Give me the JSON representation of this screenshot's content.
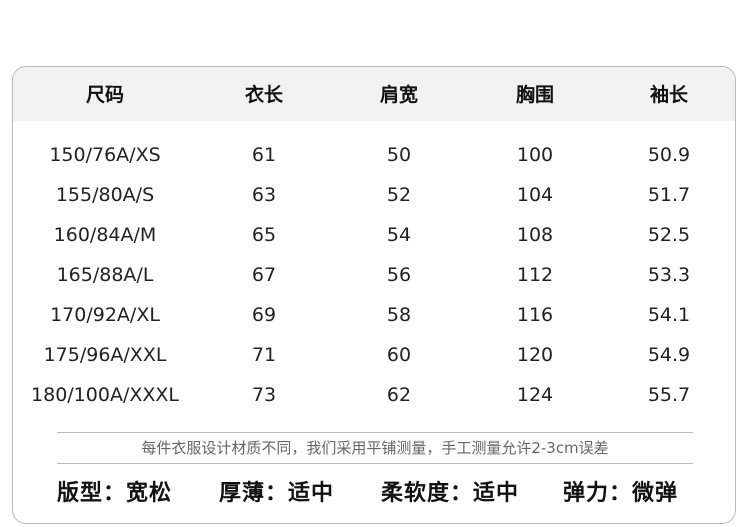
{
  "table": {
    "headers": [
      "尺码",
      "衣长",
      "肩宽",
      "胸围",
      "袖长"
    ],
    "rows": [
      [
        "150/76A/XS",
        "61",
        "50",
        "100",
        "50.9"
      ],
      [
        "155/80A/S",
        "63",
        "52",
        "104",
        "51.7"
      ],
      [
        "160/84A/M",
        "65",
        "54",
        "108",
        "52.5"
      ],
      [
        "165/88A/L",
        "67",
        "56",
        "112",
        "53.3"
      ],
      [
        "170/92A/XL",
        "69",
        "58",
        "116",
        "54.1"
      ],
      [
        "175/96A/XXL",
        "71",
        "60",
        "120",
        "54.9"
      ],
      [
        "180/100A/XXXL",
        "73",
        "62",
        "124",
        "55.7"
      ]
    ]
  },
  "note": "每件衣服设计材质不同，我们采用平铺测量，手工测量允许2-3cm误差",
  "attributes": [
    "版型：宽松",
    "厚薄：适中",
    "柔软度：适中",
    "弹力：微弹"
  ]
}
